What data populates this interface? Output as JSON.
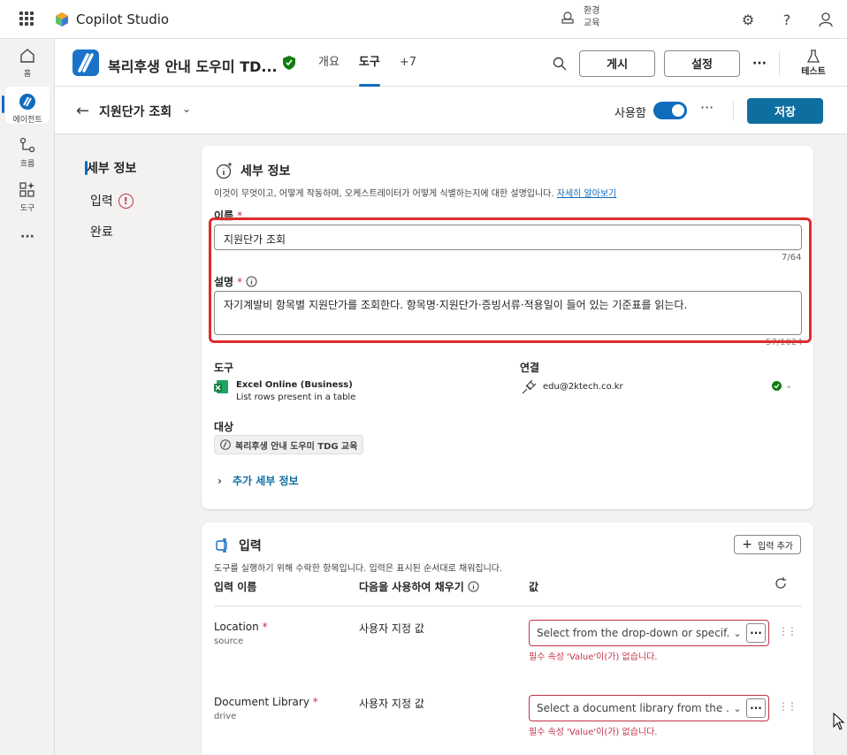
{
  "topbar": {
    "brand": "Copilot Studio",
    "env_label": "환경",
    "env_name": "교육",
    "icons": [
      "waffle-icon",
      "settings-icon",
      "help-icon",
      "person-icon"
    ]
  },
  "rail": {
    "items": [
      {
        "label": "홈",
        "icon": "home-icon"
      },
      {
        "label": "에이전트",
        "icon": "agent-icon",
        "active": true
      },
      {
        "label": "흐름",
        "icon": "flow-icon"
      },
      {
        "label": "도구",
        "icon": "tools-icon"
      }
    ],
    "more": "···"
  },
  "agent": {
    "title": "복리후생 안내 도우미 TD...",
    "tabs": [
      {
        "label": "개요"
      },
      {
        "label": "도구",
        "active": true
      },
      {
        "label": "+7"
      }
    ],
    "publish_label": "게시",
    "settings_label": "설정",
    "more": "···",
    "test_label": "테스트"
  },
  "toolbar": {
    "tool_name": "지원단가 조회",
    "enabled_label": "사용함",
    "enabled": true,
    "more": "···",
    "save_label": "저장"
  },
  "leftnav": {
    "items": [
      {
        "label": "세부 정보",
        "active": true
      },
      {
        "label": "입력",
        "warning": "!"
      },
      {
        "label": "완료"
      }
    ]
  },
  "details": {
    "title": "세부 정보",
    "desc": "이것이 무엇이고, 어떻게 작동하며, 오케스트레이터가 어떻게 식별하는지에 대한 설명입니다.",
    "learn_more": "자세히 알아보기",
    "name_label": "이름",
    "required_mark": "*",
    "name_value": "지원단가 조회",
    "name_counter": "7/64",
    "description_label": "설명",
    "description_value": "자기계발비 항목별 지원단가를 조회한다. 항목명·지원단가·증빙서류·적용일이 들어 있는 기준표를 읽는다.",
    "description_counter": "57/1024",
    "tool_label": "도구",
    "tool_name": "Excel Online (Business)",
    "tool_action": "List rows present in a table",
    "connection_label": "연결",
    "connection_value": "edu@2ktech.co.kr",
    "target_label": "대상",
    "target_chip": "복리후생 안내 도우미 TDG 교육",
    "more_details": "추가 세부 정보"
  },
  "inputs": {
    "title": "입력",
    "add_label": "입력 추가",
    "desc": "도구를 실행하기 위해 수락한 항목입니다. 입력은 표시된 순서대로 채워집니다.",
    "col_name": "입력 이름",
    "col_fill": "다음을 사용하여 채우기",
    "col_value": "값",
    "rows": [
      {
        "name": "Location",
        "sub": "source",
        "fill": "사용자 지정 값",
        "placeholder": "Select from the drop-down or specif...",
        "error": "필수 속성 'Value'이(가) 없습니다."
      },
      {
        "name": "Document Library",
        "sub": "drive",
        "fill": "사용자 지정 값",
        "placeholder": "Select a document library from the ...",
        "error": "필수 속성 'Value'이(가) 없습니다."
      }
    ]
  },
  "colors": {
    "accent": "#0f6cbd",
    "save": "#0f6ea0",
    "error": "#c4314b",
    "highlight": "#e02a2a",
    "verified": "#107c10"
  }
}
